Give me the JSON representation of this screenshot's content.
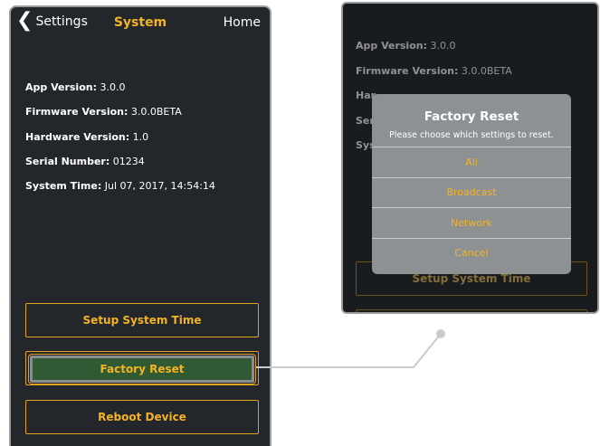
{
  "navbar": {
    "back_label": "Settings",
    "title": "System",
    "home_label": "Home"
  },
  "info": [
    {
      "label": "App Version:",
      "value": "3.0.0"
    },
    {
      "label": "Firmware Version:",
      "value": "3.0.0BETA"
    },
    {
      "label": "Hardware Version:",
      "value": "1.0"
    },
    {
      "label": "Serial Number:",
      "value": "01234"
    },
    {
      "label": "System Time:",
      "value": "Jul 07, 2017, 14:54:14"
    }
  ],
  "buttons": {
    "setup_time": "Setup System Time",
    "factory_reset": "Factory Reset",
    "reboot": "Reboot Device"
  },
  "zoom": {
    "info": [
      {
        "label": "App Version:",
        "value": "3.0.0"
      },
      {
        "label": "Firmware Version:",
        "value": "3.0.0BETA"
      },
      {
        "label": "Har",
        "value": ""
      },
      {
        "label": "Ser",
        "value": ""
      },
      {
        "label": "Sys",
        "value": ""
      }
    ],
    "setup_time": "Setup System Time",
    "dialog": {
      "title": "Factory Reset",
      "message": "Please choose which settings to reset.",
      "options": [
        "All",
        "Broadcast",
        "Network",
        "Cancel"
      ]
    }
  },
  "colors": {
    "accent": "#f4b421",
    "background": "#23272c",
    "highlight": "#2f5a34"
  }
}
